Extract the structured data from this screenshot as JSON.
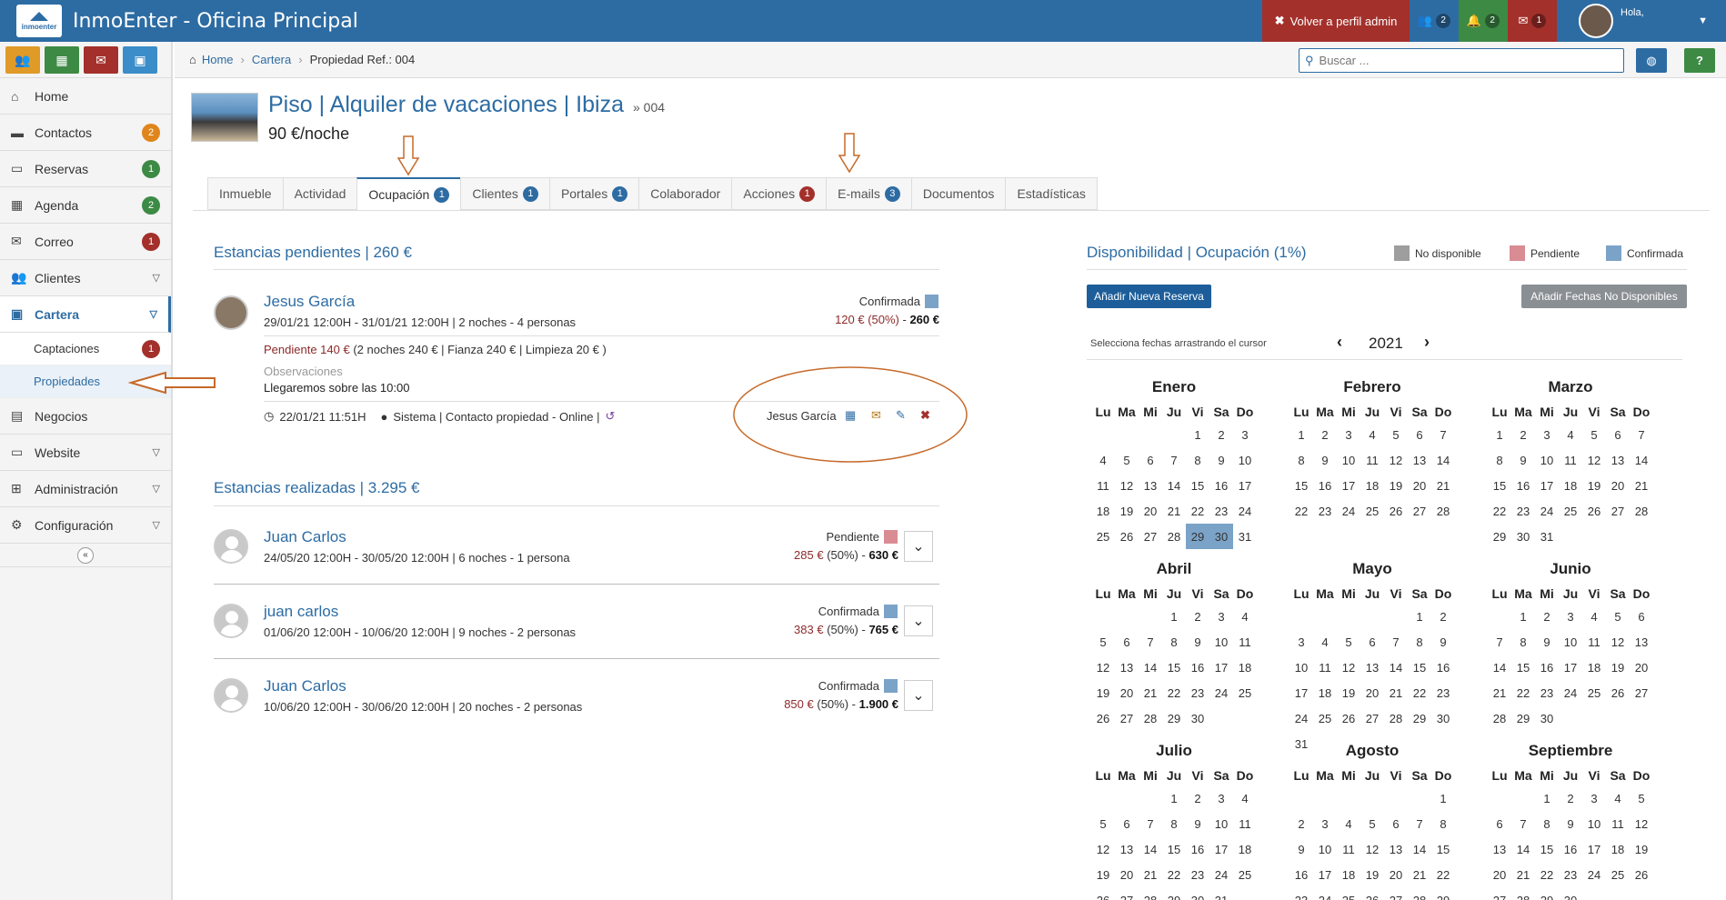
{
  "app": {
    "title": "InmoEnter - Oficina Principal",
    "logo_text": "inmoenter"
  },
  "topbar": {
    "back_label": "Volver a perfil admin",
    "users_count": "2",
    "alerts_count": "2",
    "mail_count": "1",
    "greeting": "Hola,"
  },
  "sidebar": {
    "items": [
      {
        "label": "Home"
      },
      {
        "label": "Contactos",
        "badge": "2"
      },
      {
        "label": "Reservas",
        "badge": "1"
      },
      {
        "label": "Agenda",
        "badge": "2"
      },
      {
        "label": "Correo",
        "badge": "1"
      },
      {
        "label": "Clientes"
      },
      {
        "label": "Cartera"
      },
      {
        "label": "Negocios"
      },
      {
        "label": "Website"
      },
      {
        "label": "Administración"
      },
      {
        "label": "Configuración"
      }
    ],
    "sub": [
      {
        "label": "Captaciones",
        "badge": "1"
      },
      {
        "label": "Propiedades"
      }
    ]
  },
  "breadcrumb": {
    "home": "Home",
    "cartera": "Cartera",
    "current": "Propiedad Ref.: 004"
  },
  "search": {
    "placeholder": "Buscar ..."
  },
  "property": {
    "title": "Piso | Alquiler de vacaciones | Ibiza",
    "ref": "» 004",
    "price": "90 €/noche"
  },
  "tabs": [
    {
      "label": "Inmueble"
    },
    {
      "label": "Actividad"
    },
    {
      "label": "Ocupación",
      "badge": "1"
    },
    {
      "label": "Clientes",
      "badge": "1"
    },
    {
      "label": "Portales",
      "badge": "1"
    },
    {
      "label": "Colaborador"
    },
    {
      "label": "Acciones",
      "badge": "1"
    },
    {
      "label": "E-mails",
      "badge": "3"
    },
    {
      "label": "Documentos"
    },
    {
      "label": "Estadísticas"
    }
  ],
  "pending": {
    "title": "Estancias pendientes | 260 €",
    "guest": "Jesus García",
    "dates": "29/01/21 12:00H - 31/01/21 12:00H | 2 noches - 4 personas",
    "status": "Confirmada",
    "amount_part": "120 € (50%)",
    "amount_total": "260 €",
    "pending_label": "Pendiente 140 €",
    "pending_detail": "(2 noches 240 € | Fianza 240 € | Limpieza 20 € )",
    "obs_label": "Observaciones",
    "obs_text": "Llegaremos sobre las 10:00",
    "timestamp": "22/01/21 11:51H",
    "source": "Sistema | Contacto propiedad - Online |",
    "agent": "Jesus García"
  },
  "done": {
    "title": "Estancias realizadas | 3.295 €",
    "stays": [
      {
        "name": "Juan Carlos",
        "dates": "24/05/20 12:00H - 30/05/20 12:00H | 6 noches - 1 persona",
        "status": "Pendiente",
        "part": "285 €",
        "pct": "(50%) -",
        "total": "630 €"
      },
      {
        "name": "juan carlos",
        "dates": "01/06/20 12:00H - 10/06/20 12:00H | 9 noches - 2 personas",
        "status": "Confirmada",
        "part": "383 €",
        "pct": "(50%) -",
        "total": "765 €"
      },
      {
        "name": "Juan Carlos",
        "dates": "10/06/20 12:00H - 30/06/20 12:00H | 20 noches - 2 personas",
        "status": "Confirmada",
        "part": "850 €",
        "pct": "(50%) -",
        "total": "1.900 €"
      }
    ]
  },
  "availability": {
    "title": "Disponibilidad | Ocupación (1%)",
    "legend": [
      "No disponible",
      "Pendiente",
      "Confirmada"
    ],
    "add_booking": "Añadir Nueva Reserva",
    "add_unavailable": "Añadir Fechas No Disponibles",
    "hint": "Selecciona fechas arrastrando el cursor",
    "year": "2021",
    "weekdays": [
      "Lu",
      "Ma",
      "Mi",
      "Ju",
      "Vi",
      "Sa",
      "Do"
    ],
    "months": [
      "Enero",
      "Febrero",
      "Marzo",
      "Abril",
      "Mayo",
      "Junio",
      "Julio",
      "Agosto",
      "Septiembre"
    ]
  },
  "colors": {
    "brand": "#2d6ca3",
    "confirmed": "#7ba3c8",
    "pending": "#d98c94",
    "unavailable": "#9e9e9e",
    "red_btn": "#a3302b",
    "green_btn": "#3d8a45"
  }
}
